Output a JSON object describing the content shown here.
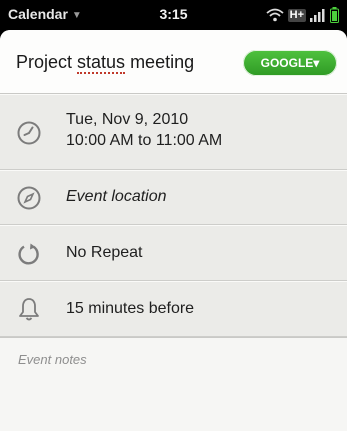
{
  "status_bar": {
    "app_name": "Calendar",
    "time": "3:15",
    "network_type": "H+"
  },
  "event": {
    "title_before": "Project ",
    "title_spellcheck": "status",
    "title_after": " meeting",
    "account_button": "GOOGLE▾",
    "date": "Tue, Nov 9, 2010",
    "time_range": "10:00 AM to 11:00 AM",
    "location_placeholder": "Event location",
    "repeat": "No Repeat",
    "reminder": "15 minutes before",
    "notes_placeholder": "Event notes"
  },
  "icons": {
    "date": "clock-icon",
    "location": "compass-icon",
    "repeat": "repeat-icon",
    "reminder": "bell-icon",
    "wifi": "wifi-icon",
    "signal": "signal-bars-icon",
    "battery": "battery-icon"
  },
  "colors": {
    "account_button": "#3aa82d",
    "spellcheck_underline": "#c0392b",
    "battery": "#4cd03c"
  }
}
